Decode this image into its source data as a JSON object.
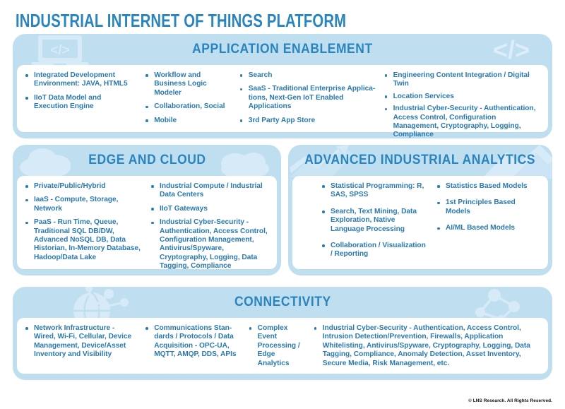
{
  "page": {
    "title": "INDUSTRIAL INTERNET OF THINGS PLATFORM",
    "copyright": "© LNS Research. All Rights Reserved.",
    "colors": {
      "title_blue": "#2a84bd",
      "card_background": "#bfdef0",
      "body_background": "#ffffff",
      "bullet_text": "#2a7ab0",
      "watermark": "#d6eaf7"
    }
  },
  "sections": [
    {
      "id": "application-enablement",
      "title": "APPLICATION ENABLEMENT",
      "icons": [
        "laptop-code-icon",
        "code-brackets-icon"
      ],
      "columns": [
        {
          "items": [
            "Integrated Development Environment: JAVA, HTML5",
            "IIoT Data Model and Execution Engine"
          ]
        },
        {
          "items": [
            "Workflow and Business Logic Modeler",
            "Collaboration, Social",
            "Mobile"
          ]
        },
        {
          "items": [
            "Search",
            "SaaS - Traditional Enterprise Applica-tions, Next-Gen IoT Enabled Applications",
            "3rd Party App Store"
          ]
        },
        {
          "items": [
            "Engineering Content Integration / Digital Twin",
            "Location Services",
            "Industrial Cyber-Security - Authentication, Access Control, Configuration Management, Cryptography, Logging, Compliance"
          ]
        }
      ]
    },
    {
      "id": "edge-and-cloud",
      "title": "EDGE AND CLOUD",
      "icons": [
        "cloud-icon",
        "cloud-icon"
      ],
      "columns": [
        {
          "items": [
            "Private/Public/Hybrid",
            "IaaS - Compute, Storage, Network",
            "PaaS - Run Time, Queue, Traditional SQL DB/DW, Advanced  NoSQL DB, Data Historian, In-Memory Database, Hadoop/Data Lake"
          ]
        },
        {
          "items": [
            "Industrial Compute / Industrial Data Centers",
            "IIoT Gateways",
            "Industrial Cyber-Security - Authentication, Access Control, Configuration Management, Antivirus/Spyware, Cryptography, Logging, Data Tagging, Compliance"
          ]
        }
      ]
    },
    {
      "id": "advanced-industrial-analytics",
      "title": "ADVANCED INDUSTRIAL ANALYTICS",
      "icons": [
        "trending-up-arrow-icon",
        "arrows-icon"
      ],
      "columns": [
        {
          "items": [
            "Statistical Programming: R, SAS, SPSS",
            "Search, Text Mining, Data Exploration, Native Language Processing",
            "Collaboration / Visualization / Reporting"
          ]
        },
        {
          "items": [
            "Statistics Based Models",
            "1st Principles Based Models",
            "AI/ML Based Models"
          ]
        }
      ]
    },
    {
      "id": "connectivity",
      "title": "CONNECTIVITY",
      "icons": [
        "network-globe-icon",
        "network-nodes-icon"
      ],
      "columns": [
        {
          "items": [
            "Network Infrastructure - Wired, Wi-Fi, Cellular, Device Management, Device/Asset Inventory and Visibility"
          ]
        },
        {
          "items": [
            "Communications Stan-dards / Protocols / Data Acquisition - OPC-UA, MQTT, AMQP, DDS, APIs"
          ]
        },
        {
          "items": [
            "Complex Event Processing / Edge Analytics"
          ]
        },
        {
          "items": [
            "Industrial Cyber-Security - Authentication, Access Control, Intrusion Detection/Prevention, Firewalls, Application Whitelisting, Antivirus/Spyware, Cryptography, Logging, Data Tagging, Compliance, Anomaly Detection, Asset Inventory, Secure Media, Risk Management, etc."
          ]
        }
      ]
    }
  ]
}
